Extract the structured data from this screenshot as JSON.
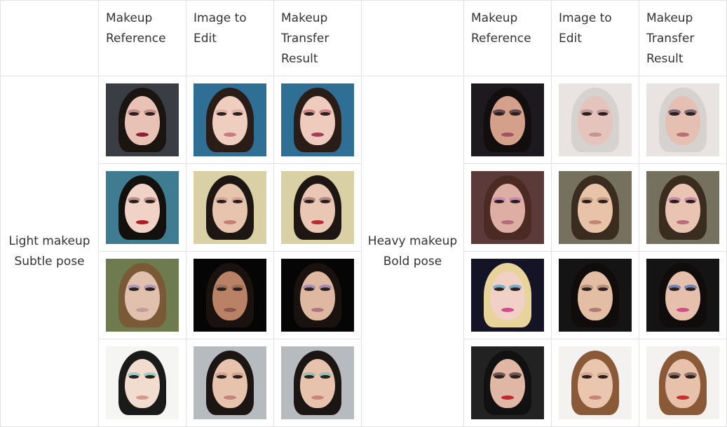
{
  "headers": {
    "left": [
      "Makeup\nReference",
      "Image to\nEdit",
      "Makeup\nTransfer\nResult"
    ],
    "right": [
      "Makeup\nReference",
      "Image to\nEdit",
      "Makeup\nTransfer\nResult"
    ]
  },
  "groups": [
    {
      "line1": "Light makeup",
      "line2": "Subtle pose"
    },
    {
      "line1": "Heavy makeup",
      "line2": "Bold pose"
    }
  ],
  "thumbnails": {
    "left": [
      [
        {
          "bg": "#3a3d44",
          "skin": "#e8c3b5",
          "hair": "#1b1512",
          "lip": "#8c1f35",
          "shadow": "#b07a80"
        },
        {
          "bg": "#2f6f96",
          "skin": "#efcdbf",
          "hair": "#2a1d17",
          "lip": "#c87a7c",
          "shadow": "#d6aa9f"
        },
        {
          "bg": "#2f6f96",
          "skin": "#eecbbd",
          "hair": "#2a1d17",
          "lip": "#a83a55",
          "shadow": "#c46a78"
        }
      ],
      [
        {
          "bg": "#3f7c92",
          "skin": "#f0d2c6",
          "hair": "#14100e",
          "lip": "#b01a22",
          "shadow": "#a77b76"
        },
        {
          "bg": "#d9d0a6",
          "skin": "#e7c4ae",
          "hair": "#1e1612",
          "lip": "#c47f78",
          "shadow": "#caa08d"
        },
        {
          "bg": "#d9d0a6",
          "skin": "#e9c7b4",
          "hair": "#1e1612",
          "lip": "#b62a34",
          "shadow": "#9d7472"
        }
      ],
      [
        {
          "bg": "#6e7b4f",
          "skin": "#e1c1ad",
          "hair": "#7a5a36",
          "lip": "#c69a98",
          "shadow": "#9c8ab8"
        },
        {
          "bg": "#050505",
          "skin": "#b98267",
          "hair": "#1a120e",
          "lip": "#8d5548",
          "shadow": "#8f6552"
        },
        {
          "bg": "#050505",
          "skin": "#dfb8a2",
          "hair": "#1a120e",
          "lip": "#b0787e",
          "shadow": "#8f7cb2"
        }
      ],
      [
        {
          "bg": "#f5f5f3",
          "skin": "#f2dccf",
          "hair": "#1a1a1a",
          "lip": "#d39a92",
          "shadow": "#7ec8c0"
        },
        {
          "bg": "#b7bbc0",
          "skin": "#e7c3ad",
          "hair": "#1b1614",
          "lip": "#c0857c",
          "shadow": "#c59c88"
        },
        {
          "bg": "#b7bbc0",
          "skin": "#e7c3ae",
          "hair": "#1b1614",
          "lip": "#c8867c",
          "shadow": "#79bdb4"
        }
      ]
    ],
    "right": [
      [
        {
          "bg": "#1c1a1e",
          "skin": "#d5a08a",
          "hair": "#120e0e",
          "lip": "#a45063",
          "shadow": "#3d2e3a"
        },
        {
          "bg": "#e9e4e2",
          "skin": "#e5c4bd",
          "hair": "#d6d2d0",
          "lip": "#c7948f",
          "shadow": "#b08a8e"
        },
        {
          "bg": "#e9e4e2",
          "skin": "#e4bfb2",
          "hair": "#d6d2d0",
          "lip": "#b7706f",
          "shadow": "#5b4a5c"
        }
      ],
      [
        {
          "bg": "#5a3b3a",
          "skin": "#dcaea4",
          "hair": "#4a2a22",
          "lip": "#b66b7a",
          "shadow": "#c37fb5"
        },
        {
          "bg": "#76705e",
          "skin": "#e8c3a7",
          "hair": "#3b2c20",
          "lip": "#c38676",
          "shadow": "#b78f7a"
        },
        {
          "bg": "#76705e",
          "skin": "#e9c4b2",
          "hair": "#3b2c20",
          "lip": "#b86d7a",
          "shadow": "#b87aa4"
        }
      ],
      [
        {
          "bg": "#141426",
          "skin": "#f1d1c6",
          "hair": "#e8d39a",
          "lip": "#d24b8e",
          "shadow": "#4aa3c9"
        },
        {
          "bg": "#141414",
          "skin": "#e3bda4",
          "hair": "#0f0c0b",
          "lip": "#b27a72",
          "shadow": "#a7826f"
        },
        {
          "bg": "#141414",
          "skin": "#e6c0ac",
          "hair": "#0f0c0b",
          "lip": "#d14e8a",
          "shadow": "#4b73b8"
        }
      ],
      [
        {
          "bg": "#222222",
          "skin": "#e0b6a4",
          "hair": "#111111",
          "lip": "#c0262f",
          "shadow": "#443638"
        },
        {
          "bg": "#f4f2f0",
          "skin": "#eac6ae",
          "hair": "#8a5a38",
          "lip": "#c68676",
          "shadow": "#c8a08a"
        },
        {
          "bg": "#f4f2f0",
          "skin": "#e8c1ab",
          "hair": "#8a5a38",
          "lip": "#c7302e",
          "shadow": "#6a4e52"
        }
      ]
    ]
  }
}
